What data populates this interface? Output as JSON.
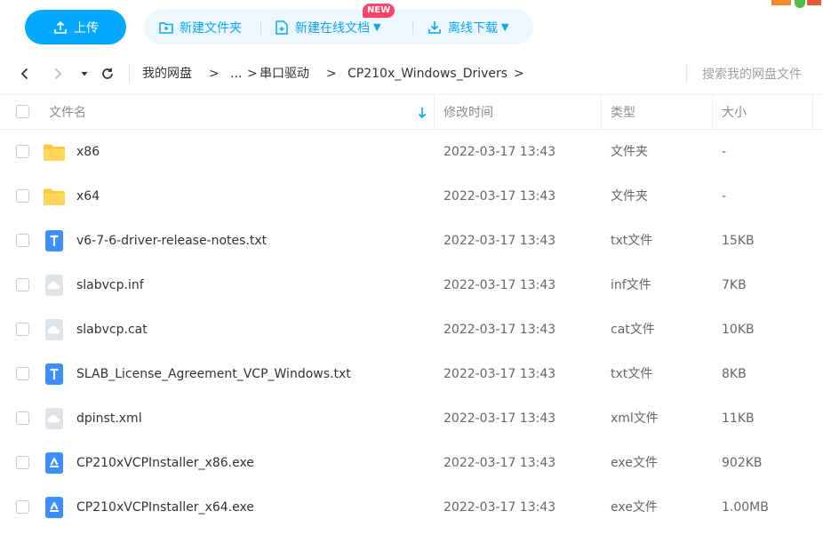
{
  "toolbar": {
    "upload_label": "上传",
    "new_folder_label": "新建文件夹",
    "new_online_doc_label": "新建在线文档",
    "new_badge": "NEW",
    "offline_download_label": "离线下载"
  },
  "nav": {
    "breadcrumb": [
      "我的网盘",
      "...",
      "串口驱动",
      "CP210x_Windows_Drivers"
    ],
    "crumb_separator": ">",
    "search_placeholder": "搜索我的网盘文件"
  },
  "table": {
    "headers": {
      "name": "文件名",
      "modified": "修改时间",
      "type": "类型",
      "size": "大小"
    },
    "rows": [
      {
        "name": "x86",
        "modified": "2022-03-17 13:43",
        "type": "文件夹",
        "size": "-",
        "icon": "folder-icon"
      },
      {
        "name": "x64",
        "modified": "2022-03-17 13:43",
        "type": "文件夹",
        "size": "-",
        "icon": "folder-icon"
      },
      {
        "name": "v6-7-6-driver-release-notes.txt",
        "modified": "2022-03-17 13:43",
        "type": "txt文件",
        "size": "15KB",
        "icon": "txt-file-icon"
      },
      {
        "name": "slabvcp.inf",
        "modified": "2022-03-17 13:43",
        "type": "inf文件",
        "size": "7KB",
        "icon": "generic-file-icon"
      },
      {
        "name": "slabvcp.cat",
        "modified": "2022-03-17 13:43",
        "type": "cat文件",
        "size": "10KB",
        "icon": "generic-file-icon"
      },
      {
        "name": "SLAB_License_Agreement_VCP_Windows.txt",
        "modified": "2022-03-17 13:43",
        "type": "txt文件",
        "size": "8KB",
        "icon": "txt-file-icon"
      },
      {
        "name": "dpinst.xml",
        "modified": "2022-03-17 13:43",
        "type": "xml文件",
        "size": "11KB",
        "icon": "generic-file-icon"
      },
      {
        "name": "CP210xVCPInstaller_x86.exe",
        "modified": "2022-03-17 13:43",
        "type": "exe文件",
        "size": "902KB",
        "icon": "exe-file-icon"
      },
      {
        "name": "CP210xVCPInstaller_x64.exe",
        "modified": "2022-03-17 13:43",
        "type": "exe文件",
        "size": "1.00MB",
        "icon": "exe-file-icon"
      }
    ]
  },
  "colors": {
    "accent": "#06a7ff",
    "pill_bg": "#eef6fe",
    "badge": "#ff436a",
    "folder": "#ffc93c",
    "txt_icon": "#3d8eff",
    "generic_icon": "#d8dce2"
  }
}
